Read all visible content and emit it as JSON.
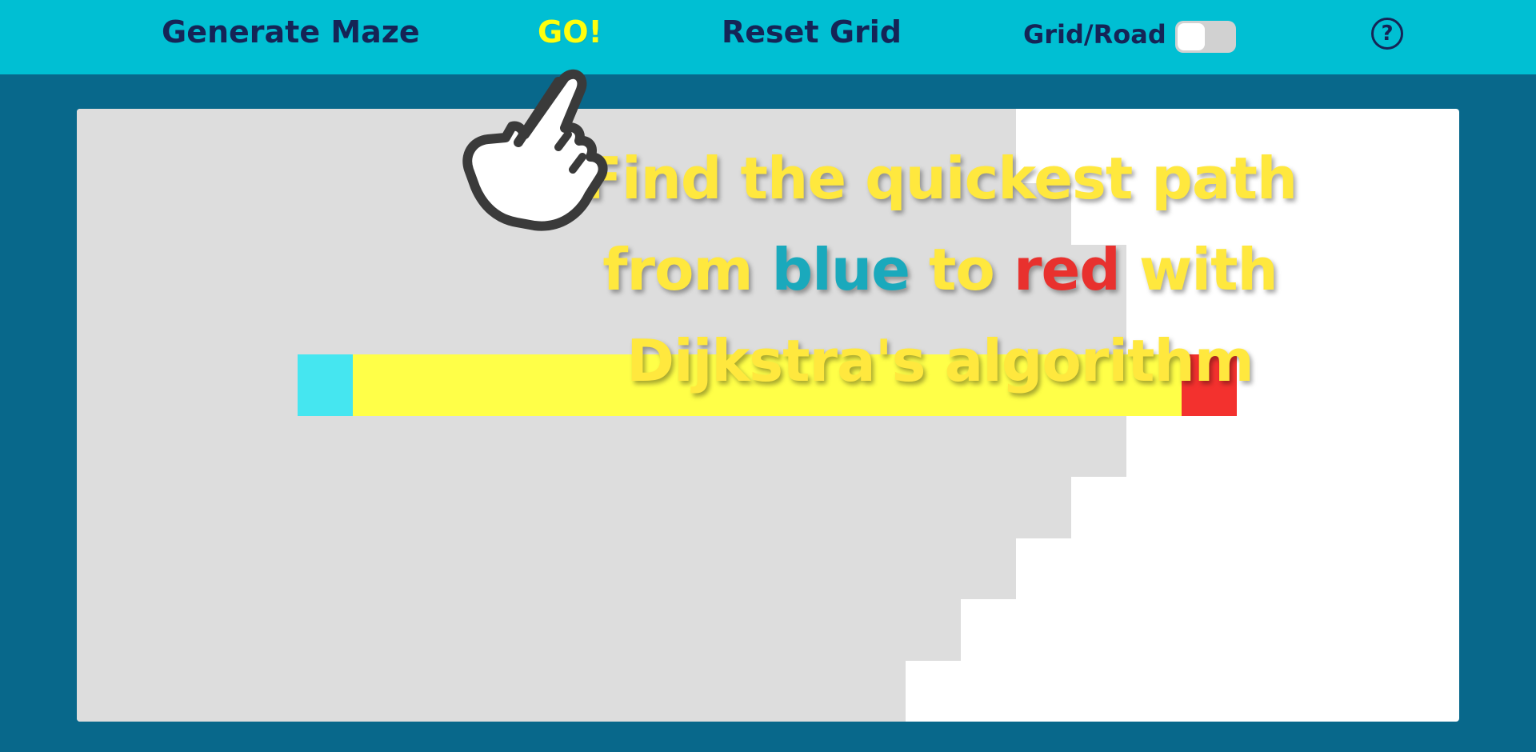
{
  "nav": {
    "generate_label": "Generate Maze",
    "go_label": "GO!",
    "reset_label": "Reset Grid",
    "toggle_label": "Grid/Road",
    "toggle_on": false,
    "help_label": "?"
  },
  "overlay": {
    "line1": "Find the quickest path",
    "line2_a": "from ",
    "line2_blue": "blue",
    "line2_b": " to ",
    "line2_red": "red",
    "line2_c": " with",
    "line3": "Dijkstra's algorithm"
  },
  "icons": {
    "pointer": "pointing-hand-icon",
    "help": "question-circle-icon"
  },
  "colors": {
    "topbar": "#00bfd3",
    "background": "#08688b",
    "visited": "#dddddd",
    "unvisited": "#ffffff",
    "start": "#45e6f0",
    "path": "#ffff48",
    "end": "#f3312e",
    "go": "#ffff0d",
    "nav_text": "#152456"
  }
}
